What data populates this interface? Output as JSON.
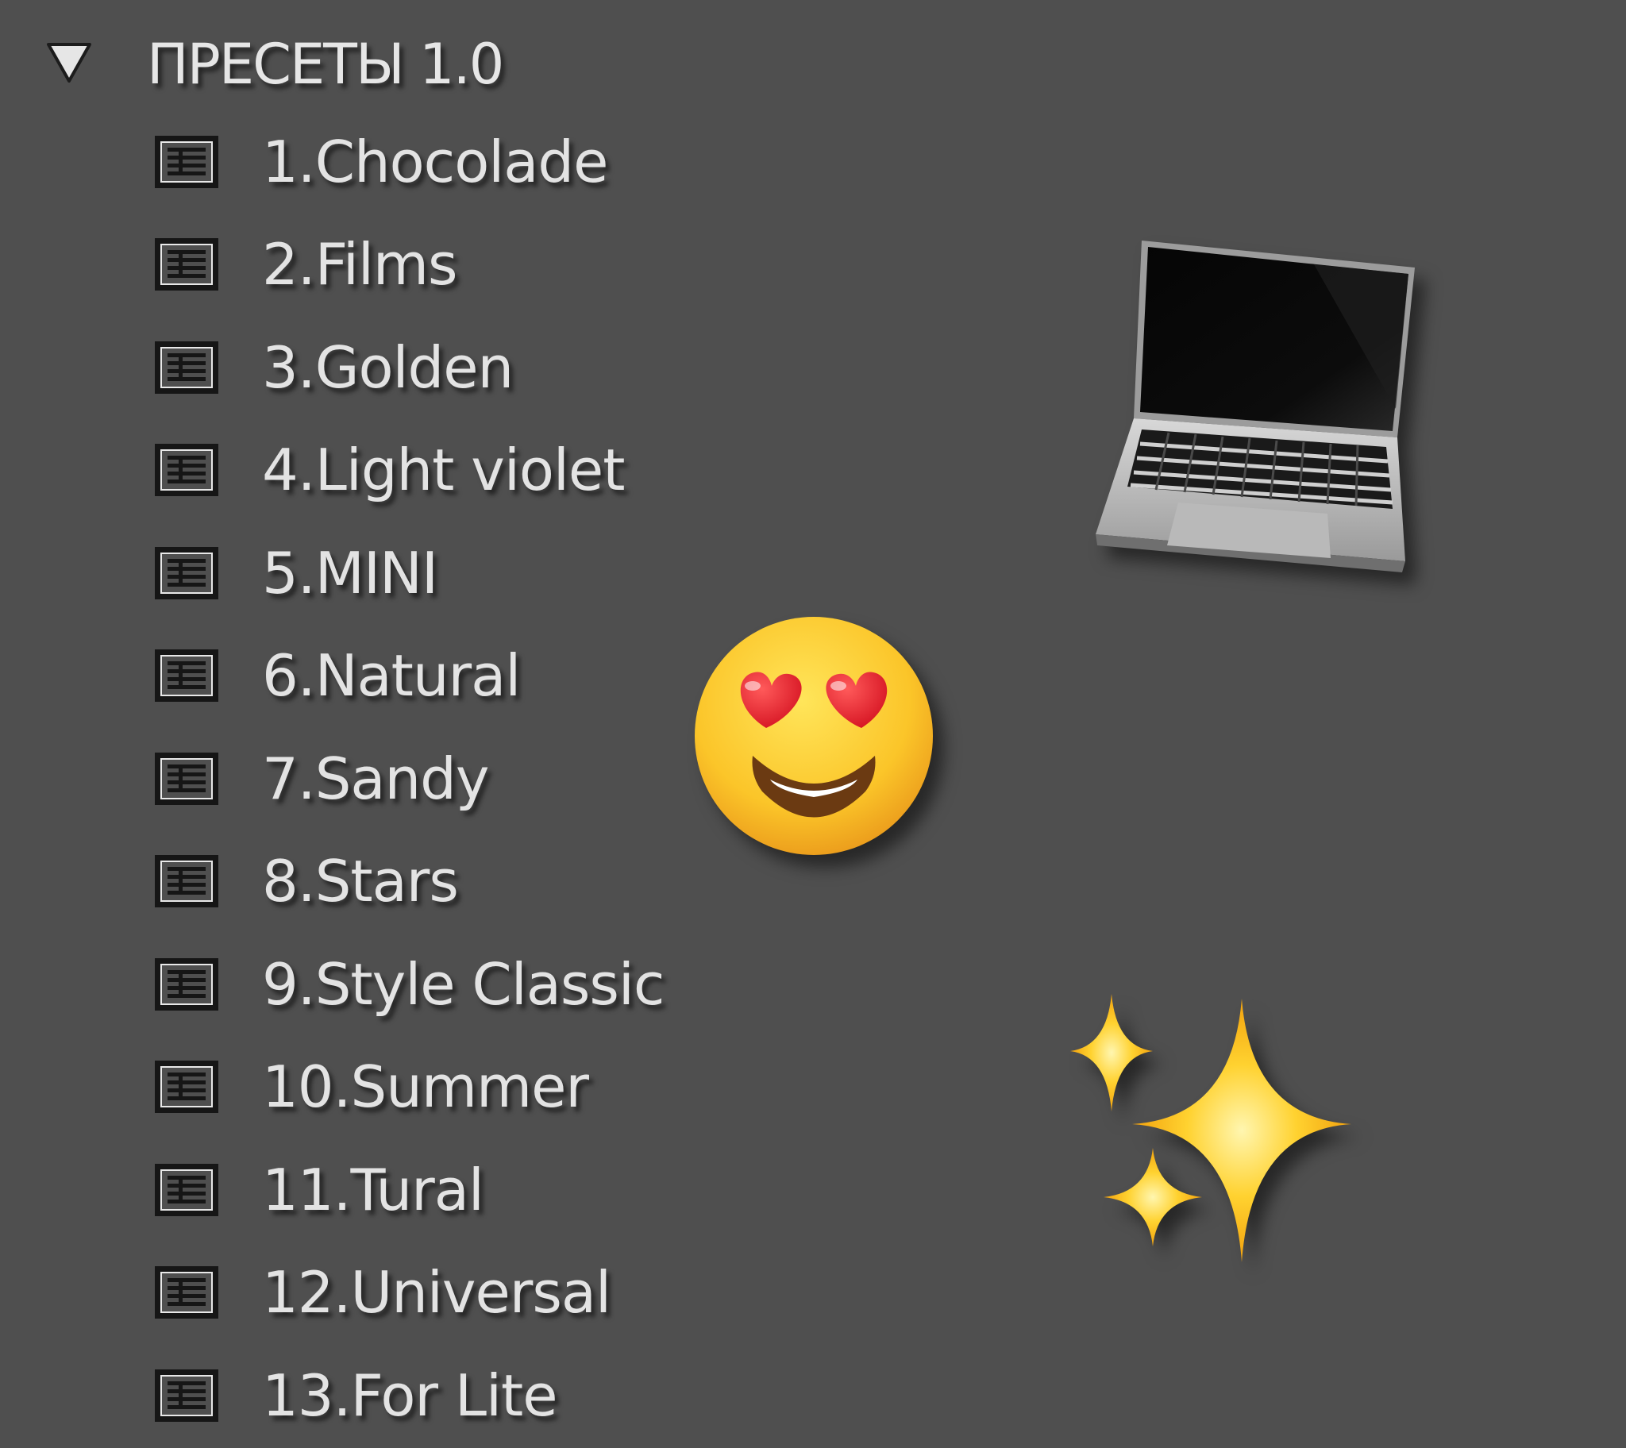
{
  "folder": {
    "title": "ПРЕСЕТЫ 1.0",
    "expanded": true
  },
  "presets": [
    {
      "label": "1.Chocolade"
    },
    {
      "label": "2.Films"
    },
    {
      "label": "3.Golden"
    },
    {
      "label": "4.Light violet"
    },
    {
      "label": "5.MINI"
    },
    {
      "label": "6.Natural"
    },
    {
      "label": "7.Sandy"
    },
    {
      "label": "8.Stars"
    },
    {
      "label": "9.Style Classic"
    },
    {
      "label": "10.Summer"
    },
    {
      "label": "11.Tural"
    },
    {
      "label": "12.Universal"
    },
    {
      "label": "13.For Lite"
    }
  ],
  "icons": {
    "disclosure": "triangle-down-icon",
    "preset": "preset-list-icon"
  },
  "stickers": [
    "laptop",
    "heart-eyes-emoji",
    "sparkles"
  ],
  "colors": {
    "background": "#4f4f4f",
    "text": "#e3e3e3"
  }
}
